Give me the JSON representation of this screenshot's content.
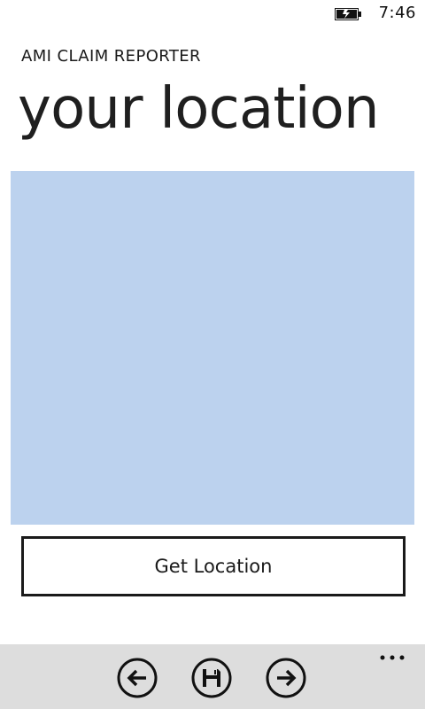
{
  "status_bar": {
    "battery_icon": "battery-charging-icon",
    "time": "7:46"
  },
  "header": {
    "app_title": "AMI CLAIM REPORTER",
    "page_title": "your location"
  },
  "map": {
    "background_color": "#bcd2ee"
  },
  "main": {
    "get_location_label": "Get Location"
  },
  "app_bar": {
    "background_color": "#dddddd",
    "buttons": [
      {
        "icon": "back-arrow-icon"
      },
      {
        "icon": "save-icon"
      },
      {
        "icon": "forward-arrow-icon"
      }
    ],
    "more_icon": "ellipsis-icon"
  }
}
